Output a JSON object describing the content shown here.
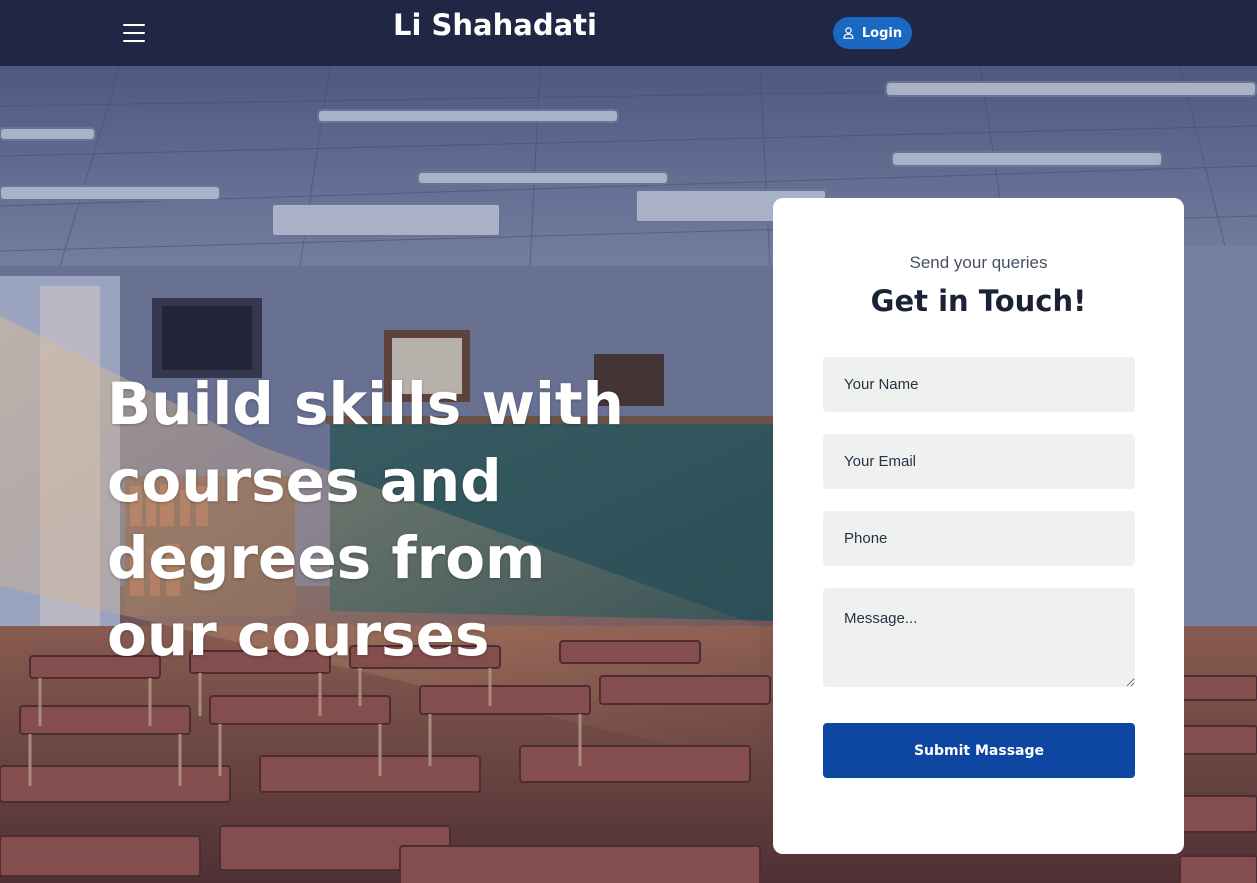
{
  "navbar": {
    "brand": "Li Shahadati",
    "login_label": "Login",
    "icons": [
      "menu-icon",
      "user-icon"
    ]
  },
  "hero": {
    "headline": "Build skills with courses and degrees from our courses"
  },
  "contact": {
    "subtitle": "Send your queries",
    "title": "Get in Touch!",
    "name_placeholder": "Your Name",
    "email_placeholder": "Your Email",
    "phone_placeholder": "Phone",
    "message_placeholder": "Message...",
    "submit_label": "Submit Massage"
  },
  "colors": {
    "navbar": "#1f2744",
    "login_button": "#1b68c2",
    "submit_button": "#0d47a1",
    "field_background": "#eff1f1"
  }
}
